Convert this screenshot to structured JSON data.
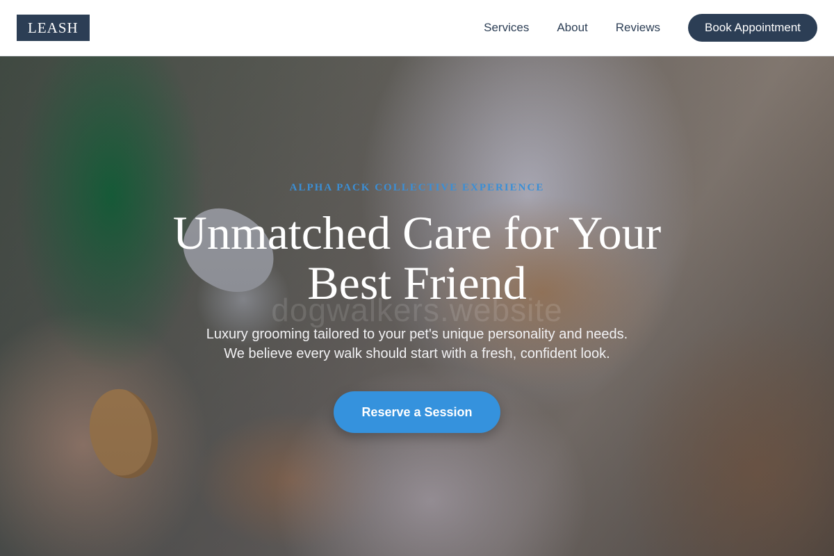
{
  "header": {
    "logo": "LEASH",
    "nav": [
      {
        "label": "Services"
      },
      {
        "label": "About"
      },
      {
        "label": "Reviews"
      }
    ],
    "cta_label": "Book Appointment"
  },
  "hero": {
    "eyebrow": "ALPHA PACK COLLECTIVE EXPERIENCE",
    "headline_line1": "Unmatched Care for Your",
    "headline_line2": "Best Friend",
    "subtext_line1": "Luxury grooming tailored to your pet's unique personality and needs.",
    "subtext_line2": "We believe every walk should start with a fresh, confident look.",
    "cta_label": "Reserve a Session",
    "watermark": "dogwalkers.website"
  },
  "colors": {
    "brand_navy": "#2c3e55",
    "accent_blue": "#3592dd",
    "eyebrow_blue": "#3b8fd6"
  },
  "icons": {
    "hero_image": "dog-grooming-photo"
  }
}
